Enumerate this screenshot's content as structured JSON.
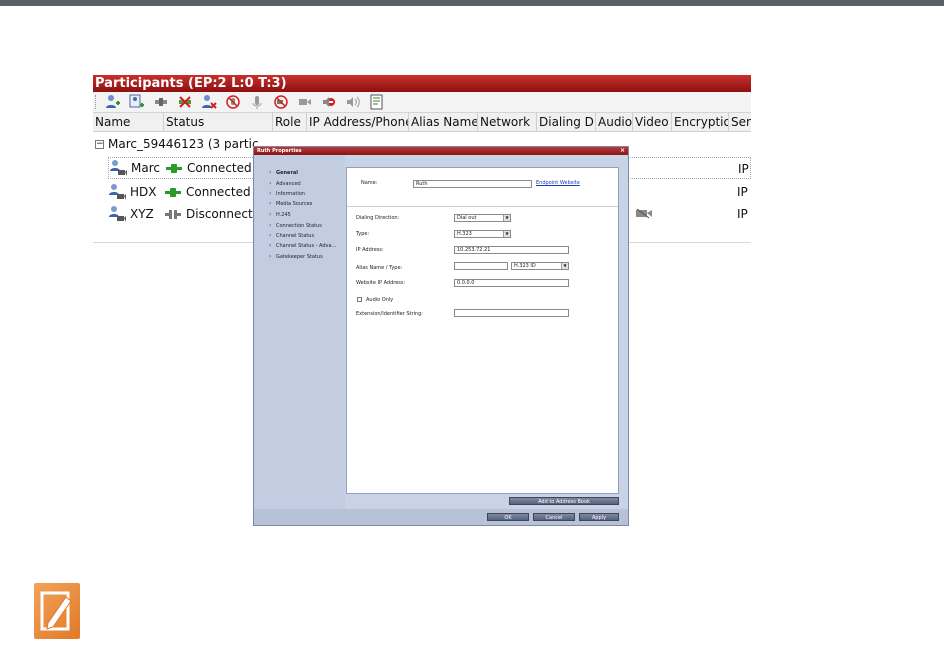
{
  "panel": {
    "title": "Participants (EP:2 L:0 T:3)",
    "columns": [
      "Name",
      "Status",
      "Role",
      "IP Address/Phone",
      "Alias Name/",
      "Network",
      "Dialing Di",
      "Audio",
      "Video",
      "Encryptio",
      "Ser"
    ],
    "conference": "Marc_59446123 (3  partic",
    "participants": [
      {
        "name": "Marc",
        "status": "Connected",
        "service": "IP"
      },
      {
        "name": "HDX",
        "status": "Connected",
        "service": "IP"
      },
      {
        "name": "XYZ",
        "status": "Disconnecte",
        "service": "IP"
      }
    ]
  },
  "dialog": {
    "title": "Ruth Properties",
    "close": "×",
    "nav": [
      "General",
      "Advanced",
      "Information",
      "Media Sources",
      "H.245",
      "Connection Status",
      "Channel Status",
      "Channel Status - Adva...",
      "Gatekeeper Status"
    ],
    "name_label": "Name:",
    "name_value": "Ruth",
    "endpoint_link": "Endpoint Website",
    "dialing_label": "Dialing Direction:",
    "dialing_value": "Dial out",
    "type_label": "Type:",
    "type_value": "H.323",
    "ip_label": "IP Address:",
    "ip_value": "10.253.72.21",
    "alias_label": "Alias Name / Type:",
    "alias_type": "H.323 ID",
    "website_label": "Website IP Address:",
    "website_value": "0.0.0.0",
    "audio_only": "Audio Only",
    "ext_label": "Extension/Identifier String:",
    "add_book": "Add to Address Book",
    "ok": "OK",
    "cancel": "Cancel",
    "apply": "Apply"
  },
  "colors": {
    "title_red": "#a81c1c",
    "note_orange": "#e8873a"
  }
}
